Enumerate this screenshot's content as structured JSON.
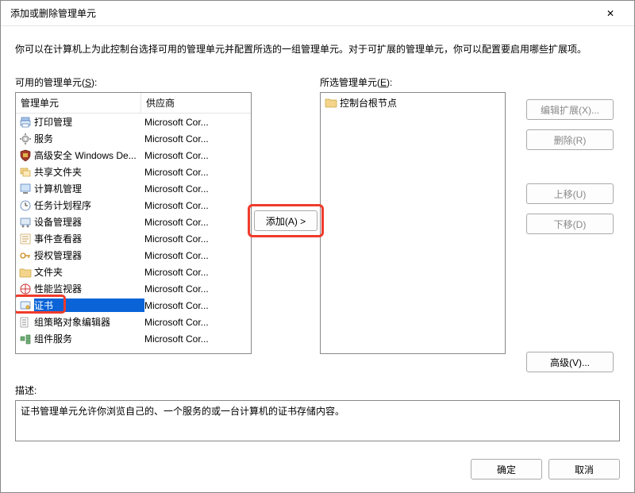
{
  "window": {
    "title": "添加或删除管理单元",
    "close_icon": "✕"
  },
  "description": "你可以在计算机上为此控制台选择可用的管理单元并配置所选的一组管理单元。对于可扩展的管理单元，你可以配置要启用哪些扩展项。",
  "available": {
    "label_pre": "可用的管理单元(",
    "label_key": "S",
    "label_post": "):",
    "headers": {
      "name": "管理单元",
      "vendor": "供应商"
    },
    "items": [
      {
        "name": "打印管理",
        "vendor": "Microsoft Cor...",
        "icon": "printer"
      },
      {
        "name": "服务",
        "vendor": "Microsoft Cor...",
        "icon": "gear"
      },
      {
        "name": "高级安全 Windows De...",
        "vendor": "Microsoft Cor...",
        "icon": "shield"
      },
      {
        "name": "共享文件夹",
        "vendor": "Microsoft Cor...",
        "icon": "share"
      },
      {
        "name": "计算机管理",
        "vendor": "Microsoft Cor...",
        "icon": "computer"
      },
      {
        "name": "任务计划程序",
        "vendor": "Microsoft Cor...",
        "icon": "clock"
      },
      {
        "name": "设备管理器",
        "vendor": "Microsoft Cor...",
        "icon": "device"
      },
      {
        "name": "事件查看器",
        "vendor": "Microsoft Cor...",
        "icon": "event"
      },
      {
        "name": "授权管理器",
        "vendor": "Microsoft Cor...",
        "icon": "key"
      },
      {
        "name": "文件夹",
        "vendor": "Microsoft Cor...",
        "icon": "folder"
      },
      {
        "name": "性能监视器",
        "vendor": "Microsoft Cor...",
        "icon": "perf"
      },
      {
        "name": "证书",
        "vendor": "Microsoft Cor...",
        "icon": "cert",
        "selected": true,
        "highlight": true
      },
      {
        "name": "组策略对象编辑器",
        "vendor": "Microsoft Cor...",
        "icon": "gpo"
      },
      {
        "name": "组件服务",
        "vendor": "Microsoft Cor...",
        "icon": "component"
      }
    ]
  },
  "selected_panel": {
    "label_pre": "所选管理单元(",
    "label_key": "E",
    "label_post": "):",
    "root": "控制台根节点"
  },
  "buttons": {
    "add": "添加(A) >",
    "edit_ext": "编辑扩展(X)...",
    "remove": "删除(R)",
    "move_up": "上移(U)",
    "move_down": "下移(D)",
    "advanced": "高级(V)...",
    "ok": "确定",
    "cancel": "取消"
  },
  "lower": {
    "label": "描述:",
    "text": "证书管理单元允许你浏览自己的、一个服务的或一台计算机的证书存储内容。"
  }
}
